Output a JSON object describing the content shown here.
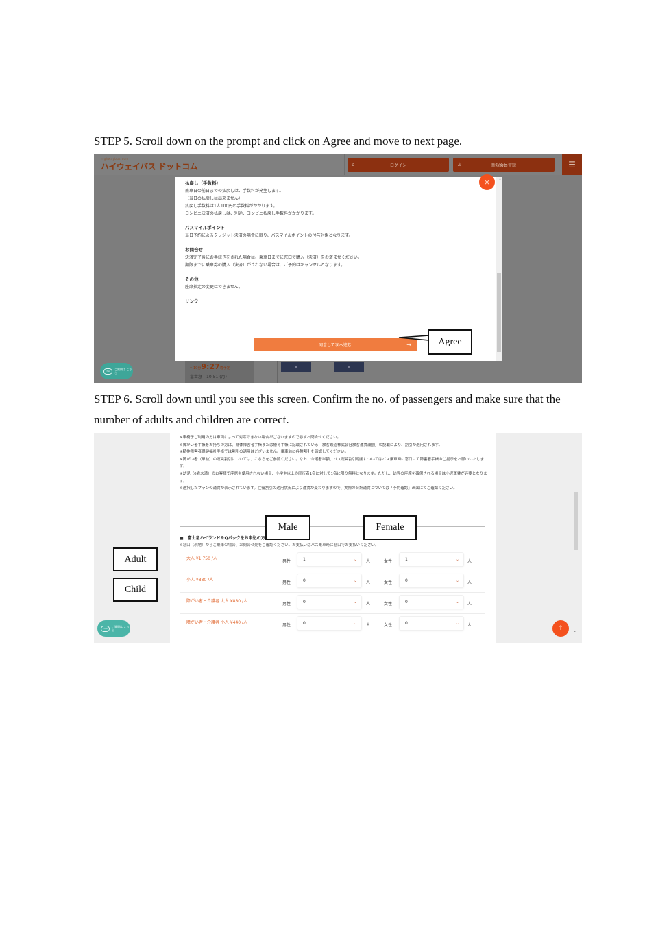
{
  "step5": {
    "instruction": "STEP 5. Scroll down on the prompt and click on Agree and move to next page.",
    "site": {
      "logo_sub": "highwaybus.com",
      "logo": "ハイウェイバス ドットコム",
      "login_label": "ログイン",
      "login_icon": "lock-icon",
      "register_label": "新規会員登録",
      "register_icon": "user-icon",
      "menu_icon": "hamburger-menu-icon"
    },
    "background": {
      "time_prefix": "～10分",
      "time": "9:27",
      "time_suffix": "着予定",
      "sub": "富士急　10:51 (月)",
      "x1": "×",
      "x2": "×"
    },
    "chat_badge": {
      "bubble": "chat",
      "text": "ご質問は こちら"
    },
    "modal": {
      "sections": [
        {
          "heading": "払戻し（手数料）",
          "lines": [
            "乗車日の前日までの払戻しは、手数料が発生します。",
            "（当日の払戻しは出来ません）",
            "払戻し手数料は1人100円の手数料がかかります。",
            "コンビニ決済の払戻しは、別途、コンビニ払戻し手数料がかかります。"
          ]
        },
        {
          "heading": "バスマイルポイント",
          "lines": [
            "当日予約によるクレジット決済の場合に限り、バスマイルポイントの付与対象となります。"
          ]
        },
        {
          "heading": "お問合せ",
          "lines": [
            "決済完了後にお手続きをされた場合は、乗車日までに窓口で購入（決済）をお済ませください。",
            "期限までに乗車券の購入（決済）がされない場合は、ご予約はキャンセルとなります。"
          ]
        },
        {
          "heading": "その他",
          "lines": [
            "座席指定の変更はできません。"
          ]
        },
        {
          "heading": "リンク",
          "lines": []
        }
      ],
      "agree_button": "同意して次へ進む",
      "agree_arrow": "→",
      "close_icon": "×",
      "scroll_up": "˄",
      "scroll_down": "˅"
    },
    "callout_agree": "Agree"
  },
  "step6": {
    "instruction": "STEP 6. Scroll down until you see this screen. Confirm the no. of passengers and make sure that the number of adults and children are correct.",
    "notes": [
      "※車椅子ご利用の方は車両によって対応できない場合がございますので必ずお問合せください。",
      "※障がい者手帳をお持ちの方は、身体障害者手帳または療育手帳に記載されている「旅客鉄道株式会社旅客運賃減額」の記載により、割引が適用されます。",
      "※精神障害者保健福祉手帳では割引の適用はございません。乗車前に各種割引を確認してください。",
      "※障がい者（単独）の運賃割引については、こちらをご参照ください。なお、介護者半額、バス運賃割引適用についてはバス乗車時に窓口にて障害者手帳のご提示をお願いいたします。",
      "※幼児（6歳未満）のお客様で座席を使用されない場合、小学生以上の同行者1名に対して1名に限り無料となります。ただし、幼児の座席を確保される場合は小児運賃が必要となります。",
      "※選択したプランの運賃が表示されています。往復割引の適用状況により運賃が変わりますので、実際の合計運賃については「予約確認」画面にてご確認ください。"
    ],
    "notes_link": "こちら",
    "pack_title": "■　富士急ハイランド＆Qパックをお申込の方",
    "pack_note": "※窓口（現地）からご乗車の場合、お問合せ先をご確認ください。お支払いはバス乗車時に窓口でお支払いください。",
    "rows": [
      {
        "fare": "大人 ¥1,750 /人",
        "male_label": "男性",
        "male_value": "1",
        "female_label": "女性",
        "female_value": "1",
        "unit": "人"
      },
      {
        "fare": "小人 ¥880 /人",
        "male_label": "男性",
        "male_value": "0",
        "female_label": "女性",
        "female_value": "0",
        "unit": "人"
      },
      {
        "fare": "障がい者・介護者 大人 ¥880 /人",
        "male_label": "男性",
        "male_value": "0",
        "female_label": "女性",
        "female_value": "0",
        "unit": "人"
      },
      {
        "fare": "障がい者・介護者 小人 ¥440 /人",
        "male_label": "男性",
        "male_value": "0",
        "female_label": "女性",
        "female_value": "0",
        "unit": "人"
      }
    ],
    "select_chevron": "⌄",
    "chat_badge": {
      "bubble": "chat",
      "text": "ご質問は こちら"
    },
    "top_button": "↑",
    "scroll_down": "˅",
    "callouts": {
      "male": "Male",
      "female": "Female",
      "adult": "Adult",
      "child": "Child"
    }
  }
}
